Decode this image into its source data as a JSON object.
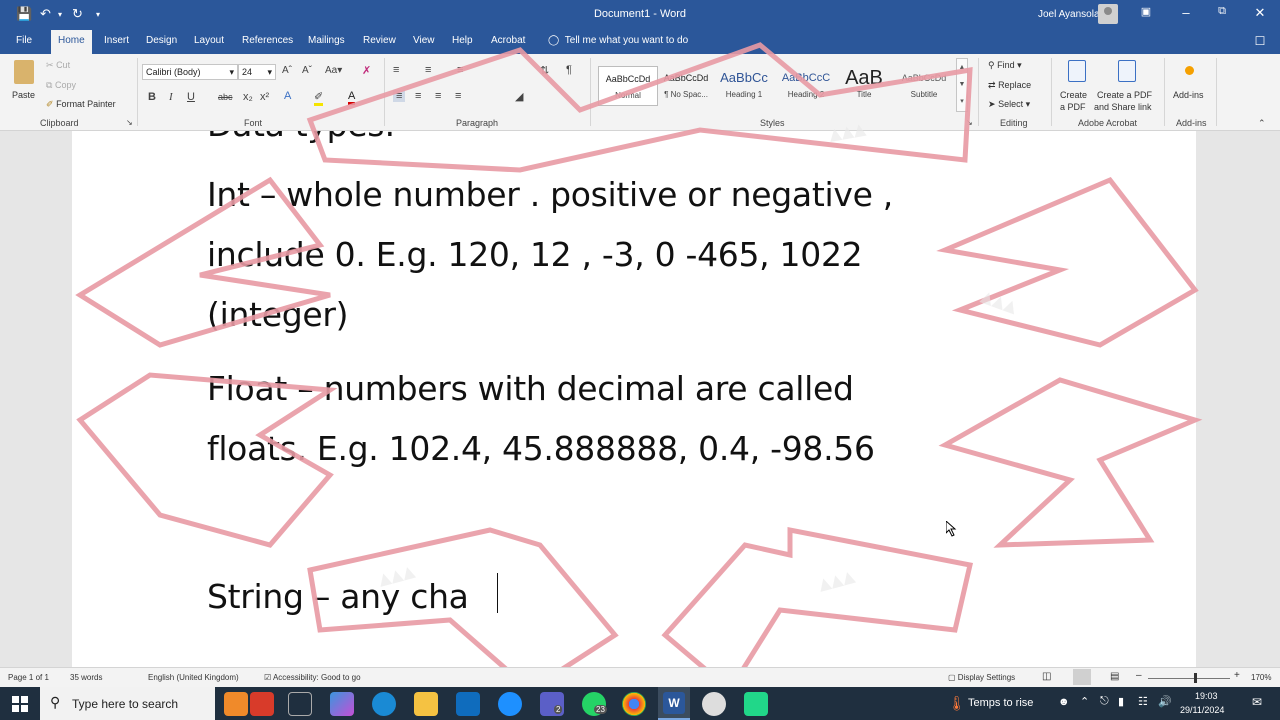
{
  "titlebar": {
    "doc_title": "Document1 - Word",
    "user_name": "Joel Ayansola"
  },
  "tabs": [
    "File",
    "Home",
    "Insert",
    "Design",
    "Layout",
    "References",
    "Mailings",
    "Review",
    "View",
    "Help",
    "Acrobat"
  ],
  "tell_me": "Tell me what you want to do",
  "ribbon": {
    "clipboard": {
      "paste": "Paste",
      "cut": "Cut",
      "copy": "Copy",
      "format_painter": "Format Painter",
      "label": "Clipboard"
    },
    "font": {
      "name": "Calibri (Body)",
      "size": "24",
      "label": "Font"
    },
    "paragraph": {
      "label": "Paragraph"
    },
    "styles": {
      "items": [
        {
          "preview": "AaBbCcDd",
          "name": "Normal"
        },
        {
          "preview": "AaBbCcDd",
          "name": "¶ No Spac..."
        },
        {
          "preview": "AaBbCc",
          "name": "Heading 1"
        },
        {
          "preview": "AaBbCcC",
          "name": "Heading 2"
        },
        {
          "preview": "AaB",
          "name": "Title"
        },
        {
          "preview": "AaBbCcDd",
          "name": "Subtitle"
        }
      ],
      "label": "Styles"
    },
    "editing": {
      "find": "Find",
      "replace": "Replace",
      "select": "Select",
      "label": "Editing"
    },
    "acrobat": {
      "create_pdf_1": "Create",
      "create_pdf_2": "a PDF",
      "share_1": "Create a PDF",
      "share_2": "and Share link",
      "label": "Adobe Acrobat"
    },
    "addins": {
      "btn": "Add-ins",
      "label": "Add-ins"
    }
  },
  "document": {
    "lines": [
      "Data types:",
      "Int – whole number . positive or negative ,",
      "include 0. E.g. 120, 12 , -3, 0 -465, 1022",
      "(integer)",
      "Float – numbers with decimal are called",
      "floats. E.g. 102.4, 45.888888, 0.4, -98.56",
      "String – any cha"
    ]
  },
  "status": {
    "page": "Page 1 of 1",
    "words": "35 words",
    "language": "English (United Kingdom)",
    "accessibility": "Accessibility: Good to go",
    "display_settings": "Display Settings",
    "zoom": "170%"
  },
  "taskbar": {
    "search_placeholder": "Type here to search",
    "weather": "Temps to rise",
    "time": "19:03",
    "date": "29/11/2024",
    "badges": [
      "2",
      "23"
    ]
  },
  "colors": {
    "word_blue": "#2b579a",
    "overlay_stroke": "#e89aa4",
    "taskbar": "#1f2f3f"
  }
}
